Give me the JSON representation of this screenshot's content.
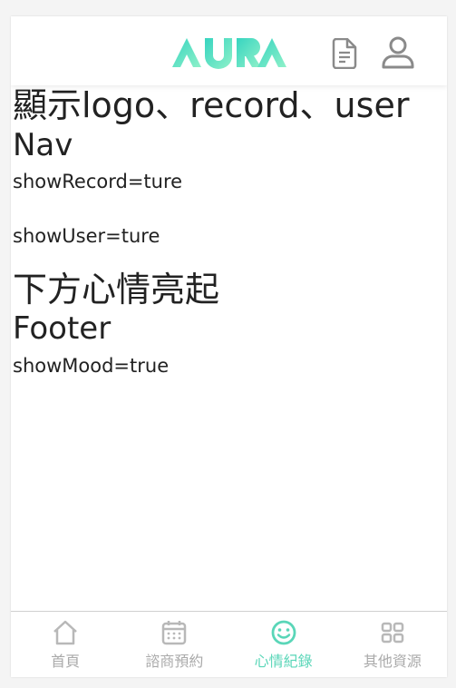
{
  "nav": {
    "logo_text": "AURA",
    "record_icon": "document-icon",
    "user_icon": "user-icon"
  },
  "content": {
    "heading1": "顯示logo、record、user",
    "heading2": "Nav",
    "line1": "showRecord=ture",
    "line2": "showUser=ture",
    "heading3": "下方心情亮起",
    "heading4": "Footer",
    "line3": "showMood=true"
  },
  "footer": {
    "tabs": [
      {
        "label": "首頁",
        "icon": "home-icon",
        "active": false
      },
      {
        "label": "諮商預約",
        "icon": "calendar-icon",
        "active": false
      },
      {
        "label": "心情紀錄",
        "icon": "smiley-icon",
        "active": true
      },
      {
        "label": "其他資源",
        "icon": "grid-icon",
        "active": false
      }
    ]
  },
  "colors": {
    "accent": "#5ad6b8",
    "accent_light": "#7fe6d4",
    "inactive": "#aaaaaa"
  }
}
